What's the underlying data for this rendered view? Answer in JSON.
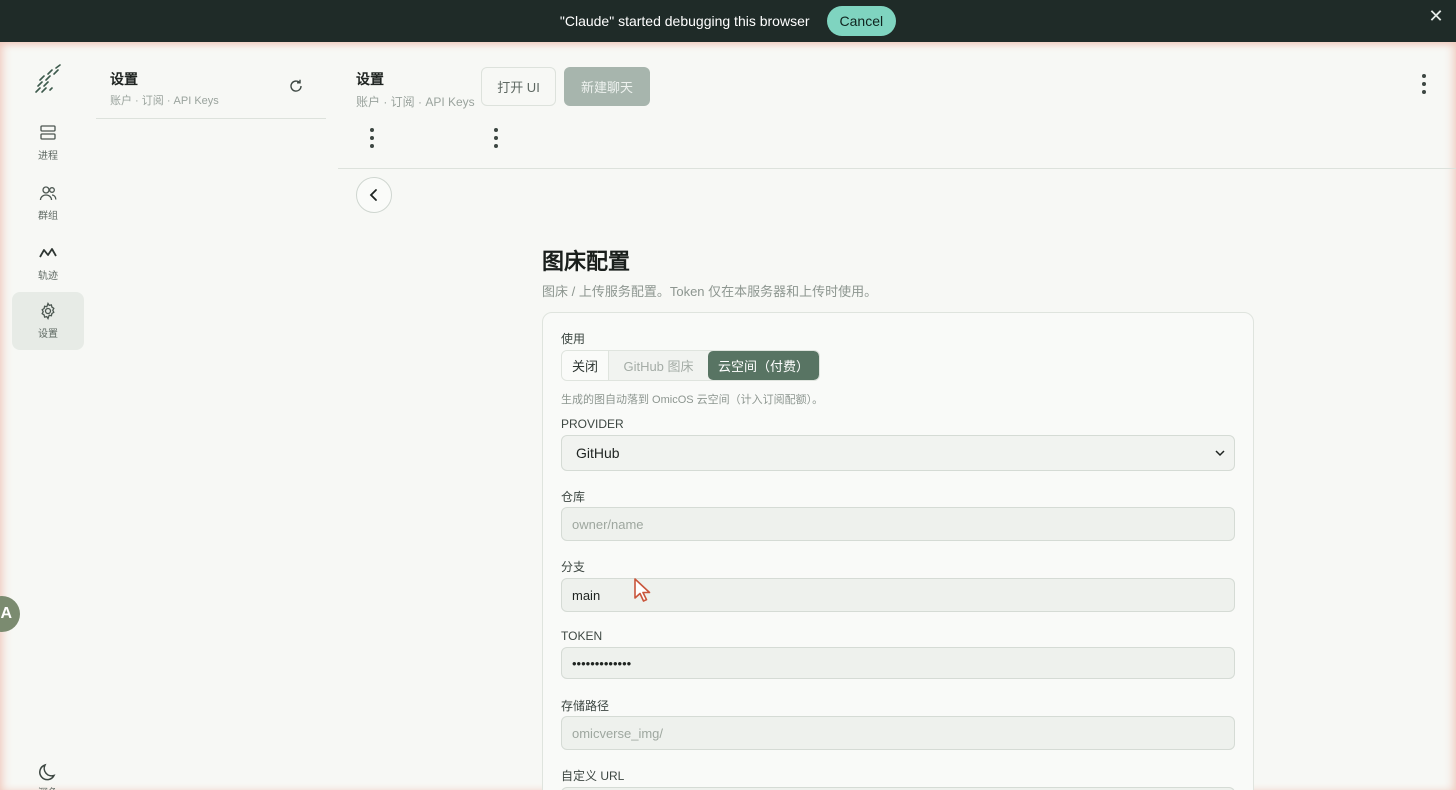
{
  "debug_bar": {
    "message": "\"Claude\" started debugging this browser",
    "cancel_label": "Cancel",
    "close_glyph": "✕"
  },
  "rail": {
    "items": [
      {
        "label": "进程",
        "icon": "server-icon"
      },
      {
        "label": "群组",
        "icon": "users-icon"
      },
      {
        "label": "轨迹",
        "icon": "trend-icon"
      },
      {
        "label": "设置",
        "icon": "gear-icon"
      }
    ],
    "theme_label": "深色",
    "avatar_letter": "A"
  },
  "sidebar": {
    "title": "设置",
    "subtitle": "账户 · 订阅 · API Keys"
  },
  "header": {
    "title": "设置",
    "subtitle": "账户 · 订阅 · API Keys",
    "open_ui_label": "打开 UI",
    "new_chat_label": "新建聊天"
  },
  "section": {
    "title": "图床配置",
    "description": "图床 / 上传服务配置。Token 仅在本服务器和上传时使用。"
  },
  "form": {
    "use_label": "使用",
    "options": [
      "关闭",
      "GitHub 图床",
      "云空间（付费）"
    ],
    "selected_option": "云空间（付费）",
    "hint": "生成的图自动落到 OmicOS 云空间（计入订阅配额）。",
    "provider_label": "PROVIDER",
    "provider_value": "GitHub",
    "repo_label": "仓库",
    "repo_placeholder": "owner/name",
    "branch_label": "分支",
    "branch_value": "main",
    "token_label": "TOKEN",
    "token_value": "•••••••••••••",
    "path_label": "存储路径",
    "path_placeholder": "omicverse_img/",
    "custom_url_label": "自定义 URL"
  },
  "colors": {
    "accent": "#587463",
    "banner": "#1f2b28",
    "cancel": "#7fd4c0"
  }
}
